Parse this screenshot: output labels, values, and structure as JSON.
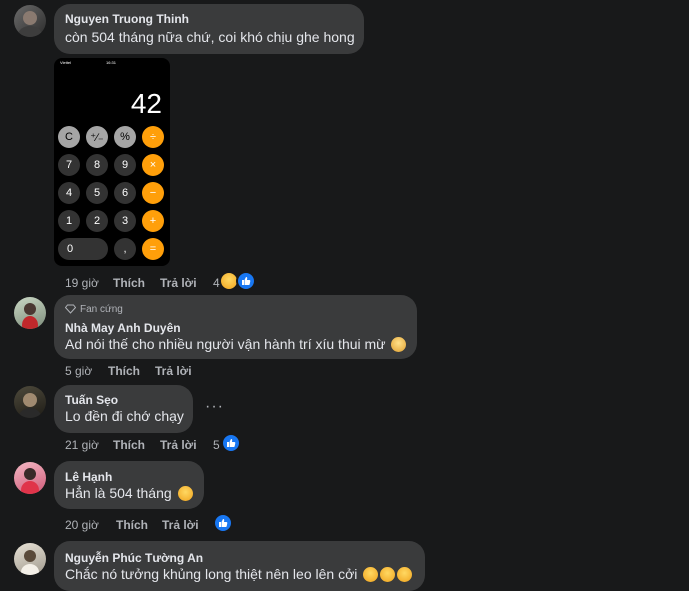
{
  "comments": [
    {
      "author": "Nguyen Truong Thinh",
      "text": "còn 504 tháng nữa chứ, coi khó chịu ghe hong",
      "time": "19 giờ",
      "like": "Thích",
      "reply": "Trả lời",
      "reaction_count": "4",
      "attachment": {
        "status_carrier": "Viettel",
        "status_time": "16:31",
        "display": "42",
        "keys": [
          [
            "C",
            "⁺∕₋",
            "%",
            "÷"
          ],
          [
            "7",
            "8",
            "9",
            "×"
          ],
          [
            "4",
            "5",
            "6",
            "−"
          ],
          [
            "1",
            "2",
            "3",
            "+"
          ],
          [
            "0",
            ",",
            "="
          ]
        ]
      }
    },
    {
      "badge": "Fan cứng",
      "author": "Nhà May Anh Duyên",
      "text": "Ad nói thế cho nhiều người vận hành trí xíu thui mừ",
      "time": "5 giờ",
      "like": "Thích",
      "reply": "Trả lời"
    },
    {
      "author": "Tuấn Sẹo",
      "text": "Lo đền đi chớ chạy",
      "time": "21 giờ",
      "like": "Thích",
      "reply": "Trả lời",
      "reaction_count": "5",
      "more": "···"
    },
    {
      "author": "Lê Hạnh",
      "text": "Hẳn là 504 tháng",
      "time": "20 giờ",
      "like": "Thích",
      "reply": "Trả lời"
    },
    {
      "author": "Nguyễn Phúc Tường An",
      "text": "Chắc nó tưởng khủng long thiệt nên leo lên cởi"
    }
  ],
  "colors": {
    "background": "#18191a",
    "bubble": "#3a3b3c",
    "like_blue": "#1877f2",
    "calc_orange": "#ff9f0a"
  }
}
